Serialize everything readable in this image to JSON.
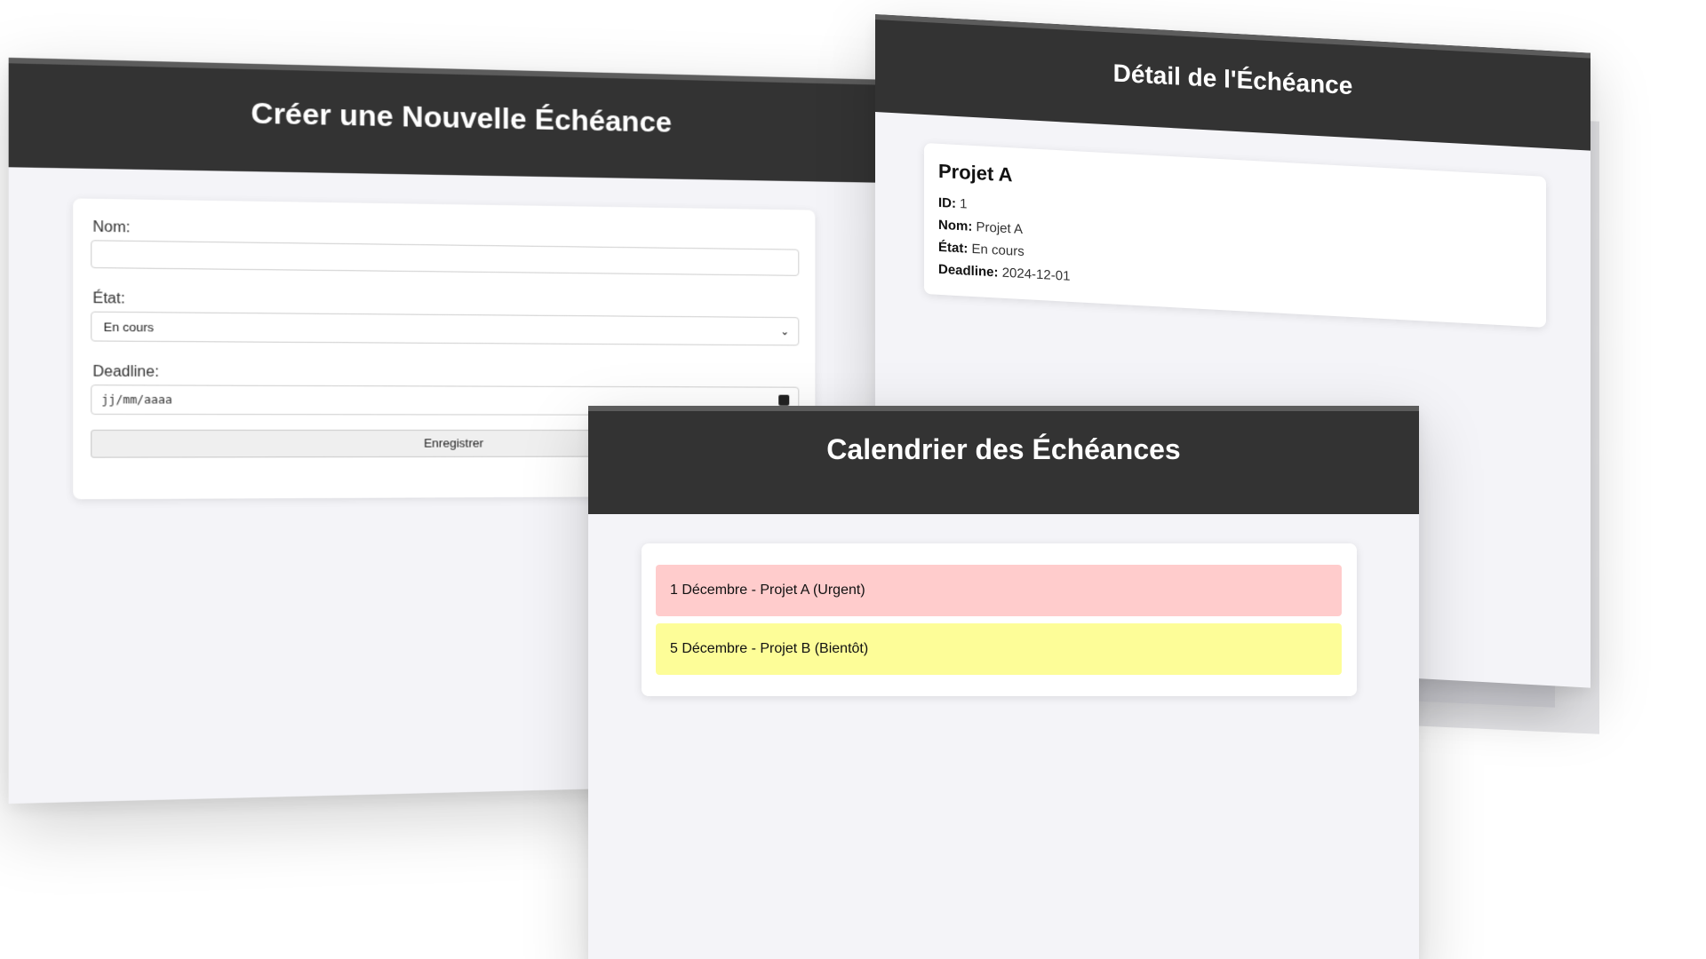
{
  "create_window": {
    "title": "Créer une Nouvelle Échéance",
    "form": {
      "nom_label": "Nom:",
      "nom_value": "",
      "etat_label": "État:",
      "etat_selected": "En cours",
      "deadline_label": "Deadline:",
      "deadline_placeholder": "jj/mm/aaaa",
      "save_label": "Enregistrer"
    }
  },
  "detail_window": {
    "title": "Détail de l'Échéance",
    "card": {
      "name": "Projet A",
      "id_label": "ID:",
      "id_value": "1",
      "nom_label": "Nom:",
      "nom_value": "Projet A",
      "etat_label": "État:",
      "etat_value": "En cours",
      "deadline_label": "Deadline:",
      "deadline_value": "2024-12-01"
    }
  },
  "calendar_window": {
    "title": "Calendrier des Échéances",
    "items": [
      {
        "label": "1 Décembre - Projet A (Urgent)",
        "color": "#ffcccc"
      },
      {
        "label": "5 Décembre - Projet B (Bientôt)",
        "color": "#fdfd98"
      }
    ]
  },
  "colors": {
    "header": "#333333",
    "background": "#f4f4f8",
    "urgent": "#ffcccc",
    "soon": "#fdfd98"
  }
}
